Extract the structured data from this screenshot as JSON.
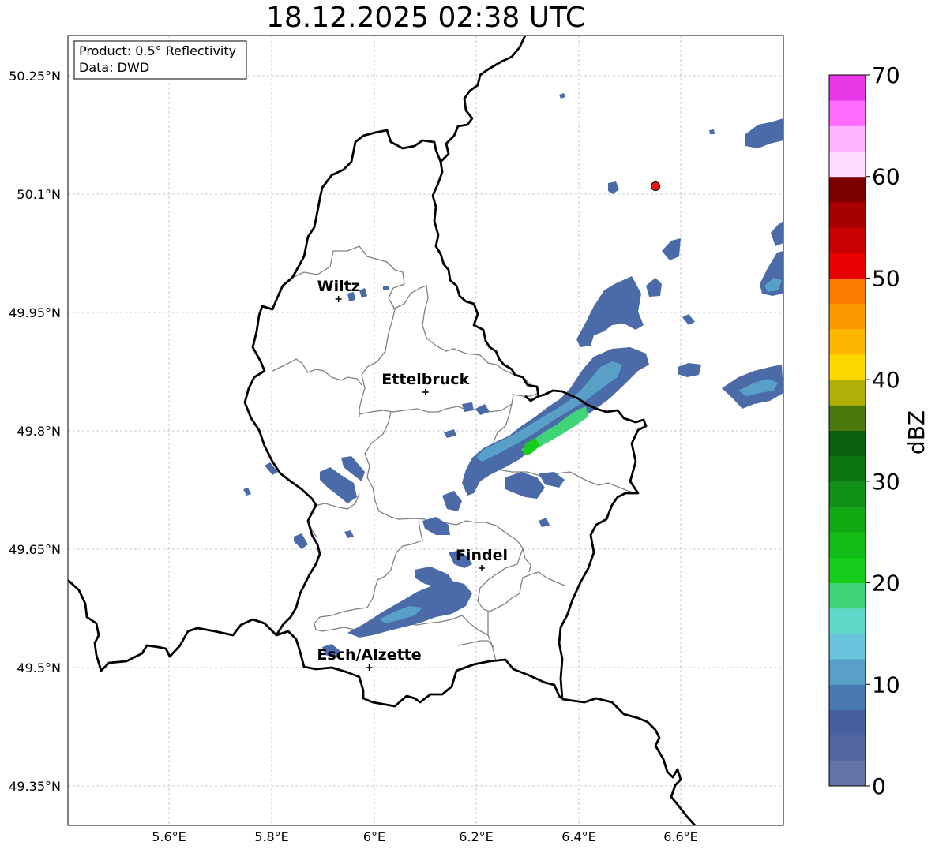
{
  "title": "18.12.2025 02:38 UTC",
  "info_box": {
    "product": "Product: 0.5° Reflectivity",
    "data": "Data: DWD"
  },
  "axes": {
    "lat_ticks": [
      "50.25°N",
      "50.1°N",
      "49.95°N",
      "49.8°N",
      "49.65°N",
      "49.5°N",
      "49.35°N"
    ],
    "lon_ticks": [
      "5.6°E",
      "5.8°E",
      "6°E",
      "6.2°E",
      "6.4°E",
      "6.6°E"
    ],
    "grid": true
  },
  "cities": [
    {
      "name": "Wiltz",
      "lon": 5.93,
      "lat": 49.967
    },
    {
      "name": "Ettelbruck",
      "lon": 6.1,
      "lat": 49.849
    },
    {
      "name": "Findel",
      "lon": 6.21,
      "lat": 49.626
    },
    {
      "name": "Esch/Alzette",
      "lon": 5.99,
      "lat": 49.5
    }
  ],
  "radar_site": {
    "lon": 6.55,
    "lat": 50.11,
    "color": "#e8141a"
  },
  "colorbar": {
    "label": "dBZ",
    "ticks": [
      "0",
      "10",
      "20",
      "30",
      "40",
      "50",
      "60",
      "70"
    ],
    "colors": [
      "#6472a8",
      "#5366a0",
      "#475f9e",
      "#4a78b0",
      "#58a0c8",
      "#68c4dc",
      "#60d8c8",
      "#40d478",
      "#18cc1c",
      "#14bc18",
      "#12a814",
      "#109014",
      "#0c7610",
      "#0a600c",
      "#4a7a0c",
      "#b0b008",
      "#fcd800",
      "#fcb800",
      "#fc9800",
      "#fc7c00",
      "#e80000",
      "#c80000",
      "#a80000",
      "#7c0000",
      "#ffdcff",
      "#ffb4ff",
      "#ff6cff",
      "#e838e8"
    ]
  }
}
